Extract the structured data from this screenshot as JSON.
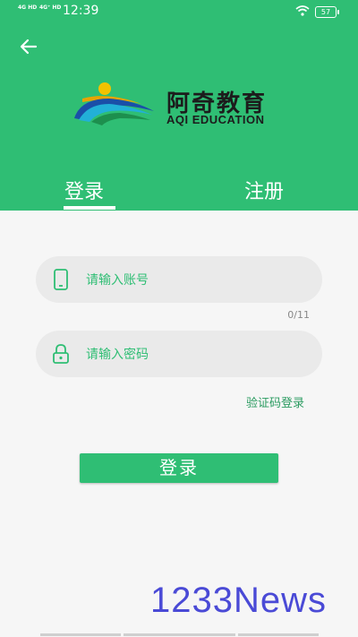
{
  "status_bar": {
    "signal1": "4G HD",
    "signal2": "4G⁺ HD",
    "time": "12:39",
    "battery": "57"
  },
  "brand": {
    "name_cn": "阿奇教育",
    "name_en": "AQI EDUCATION"
  },
  "tabs": {
    "login": "登录",
    "register": "注册",
    "active": "login"
  },
  "form": {
    "account_placeholder": "请输入账号",
    "account_counter": "0/11",
    "password_placeholder": "请输入密码",
    "sms_login_link": "验证码登录",
    "submit_label": "登录"
  },
  "watermark": "1233News",
  "colors": {
    "primary": "#2fbe74",
    "background": "#f6f6f6",
    "field_bg": "#eaeaea",
    "link": "#2a9b60"
  },
  "icons": [
    "back-arrow-icon",
    "phone-icon",
    "lock-icon",
    "wifi-icon",
    "battery-icon"
  ]
}
